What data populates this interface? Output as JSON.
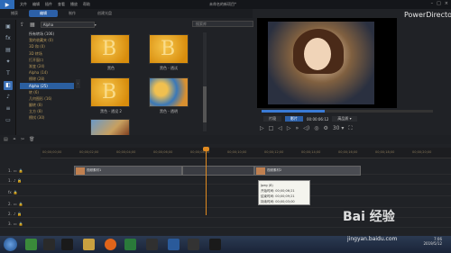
{
  "app": {
    "title": "未命名的新项目*",
    "brand": "PowerDirector",
    "menu": [
      "文件",
      "编辑",
      "插件",
      "查看",
      "播放",
      "帮助"
    ]
  },
  "tabs": [
    "捕获",
    "编辑",
    "制作",
    "创建光盘"
  ],
  "filter": {
    "dropdown": "Alpha",
    "search_placeholder": "搜索库"
  },
  "categories": [
    "所有转场 (106)",
    "我的收藏夹 (0)",
    "3D 和 (0)",
    "3D 转场",
    "打开窗口",
    "渐变 (24)",
    "Alpha (14)",
    "擦除 (28)",
    "Alpha (25)",
    "转 (6)",
    "几何图形 (16)",
    "翻转 (8)",
    "立方 (8)",
    "擦拭 (30)"
  ],
  "selected_category": "Alpha (25)",
  "thumbs": [
    {
      "label": "黑色"
    },
    {
      "label": "黑色 - 透试"
    },
    {
      "label": "黑色 - 透设 2"
    },
    {
      "label": "黑色 - 透明"
    },
    {
      "label": ""
    }
  ],
  "player": {
    "modes": [
      "片段",
      "影片"
    ],
    "timecode": "00:00:06:12",
    "quality_label": "高品质 ▾",
    "zoom": "30 ▾"
  },
  "timeline": {
    "ticks": [
      "00;00;00;00",
      "00;00;02;00",
      "00;00;04;00",
      "00;00;06;00",
      "00;00;08;00",
      "00;00;10;00",
      "00;00;12;00",
      "00;00;14;00",
      "00;00;16;00",
      "00;00;18;00",
      "00;00;20;00"
    ],
    "tracks": [
      "1.",
      "1.",
      "fx",
      "2.",
      "2.",
      "3."
    ],
    "clips": [
      {
        "label": "视频素材1"
      },
      {
        "label": "视频素材2"
      }
    ]
  },
  "tooltip": {
    "lines": [
      "Jpeg (8)",
      "开始时间: 00;00;06;21",
      "结束时间: 00;00;09;21",
      "持续时间: 00;00;03;00"
    ]
  },
  "taskbar": {
    "time": "7:06",
    "date": "2019/5/12"
  },
  "watermark": {
    "text": "Bai 经验",
    "url": "jingyan.baidu.com"
  }
}
